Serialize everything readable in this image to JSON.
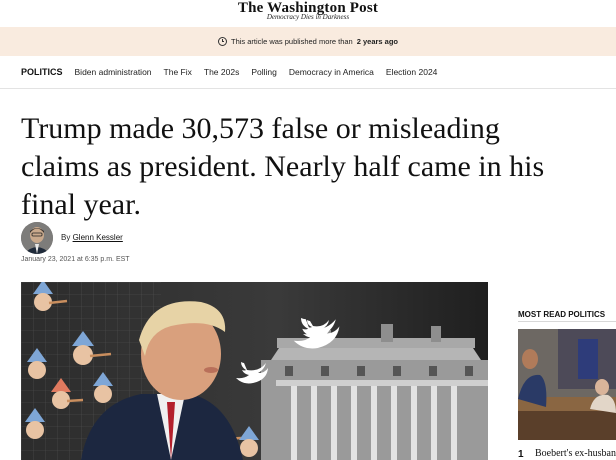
{
  "masthead": {
    "logo": "The Washington Post",
    "tagline": "Democracy Dies in Darkness"
  },
  "notice": {
    "prefix": "This article was published more than",
    "emphasis": "2 years ago"
  },
  "nav": {
    "section": "POLITICS",
    "items": [
      "Biden administration",
      "The Fix",
      "The 202s",
      "Polling",
      "Democracy in America",
      "Election 2024"
    ]
  },
  "article": {
    "headline": "Trump made 30,573 false or misleading claims as president. Nearly half came in his final year.",
    "byline_prefix": "By",
    "author": "Glenn Kessler",
    "date": "January 23, 2021 at 6:35 p.m. EST"
  },
  "sidebar": {
    "title": "MOST READ POLITICS",
    "rank": "1",
    "headline": "Boebert's ex-husband"
  },
  "colors": {
    "notice_bg": "#f9ebdf",
    "link": "#111111"
  }
}
